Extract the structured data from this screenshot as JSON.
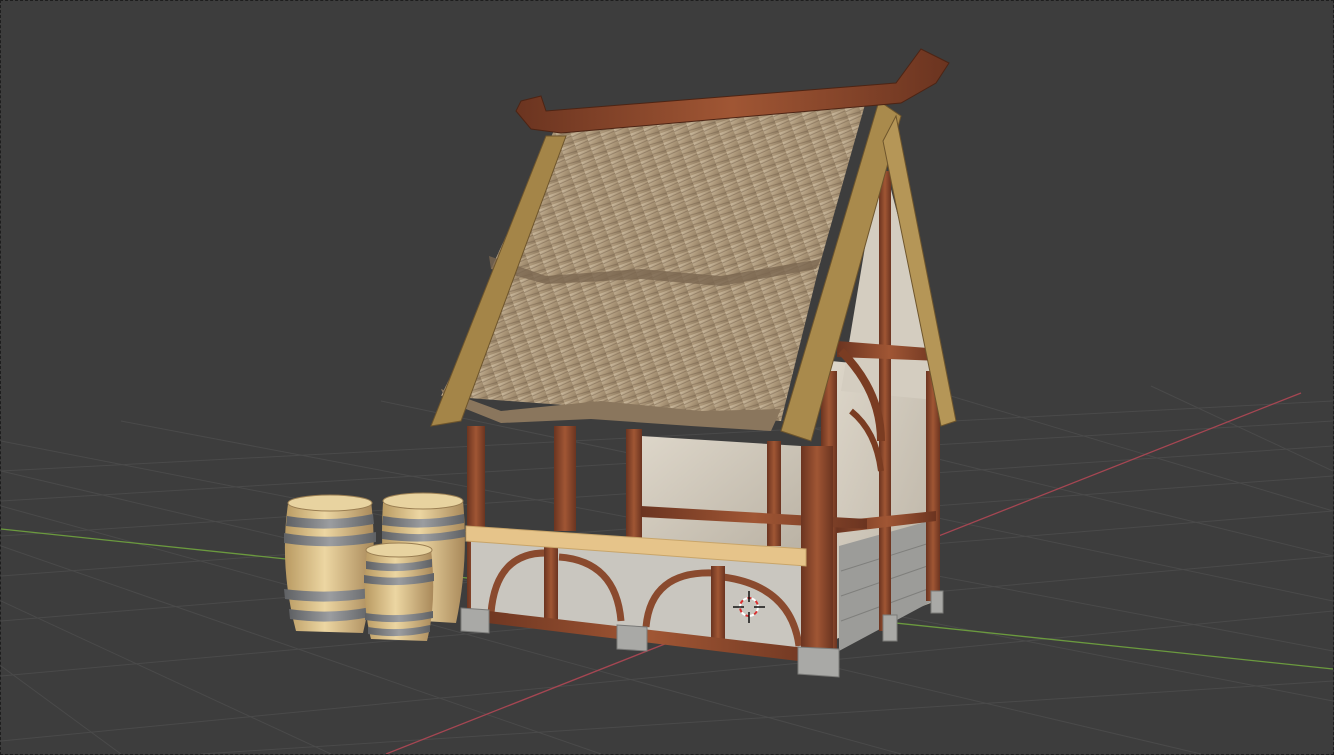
{
  "app": "3d-viewport",
  "viewport": {
    "background": "#3d3d3d",
    "grid_color": "#4a4a4a",
    "x_axis_color": "#a54652",
    "y_axis_color": "#6b9a3e"
  },
  "scene": {
    "objects": [
      {
        "name": "market-stall",
        "roof_material": "thatch",
        "frame_material": "wood",
        "walls": "plaster",
        "base": "stone"
      },
      {
        "name": "barrel",
        "count": 3
      }
    ],
    "colors": {
      "thatch": "#b8a487",
      "thatch_dark": "#7a6650",
      "beam": "#8a4a2e",
      "beam_dark": "#5e2f1c",
      "roof_edge": "#9a7a45",
      "plaster": "#cfc9bd",
      "counter": "#e6c48a",
      "stone": "#a9a9a6",
      "barrel_wood": "#d9bd86",
      "barrel_hoop": "#7d7f82"
    }
  },
  "cursor_3d": {
    "icon": "3d-cursor-icon"
  }
}
